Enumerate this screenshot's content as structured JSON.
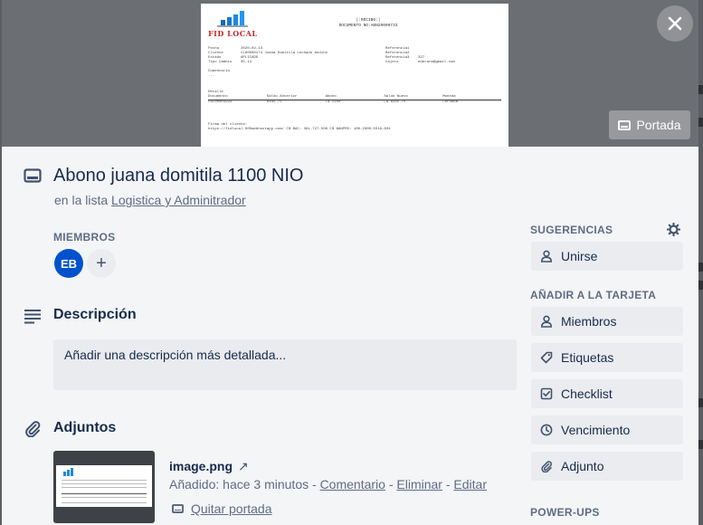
{
  "cover": {
    "portada_label": "Portada",
    "receipt": {
      "logo_text": "FID LOCAL",
      "title_line1": "|:RECIBO:|",
      "title_line2": "DOCUMENTO NO:ABN20000733",
      "fields": [
        {
          "k1": "Fecha",
          "v1": "2020-02-13",
          "k2": "Referencia1",
          "v2": ""
        },
        {
          "k1": "Cliente",
          "v1": "CL00000174 Juana Domitila Lechado Andino",
          "k2": "Referencia2",
          "v2": ""
        },
        {
          "k1": "Estado",
          "v1": "APLICADO",
          "k2": "Referencia3",
          "v2": "327"
        },
        {
          "k1": "Tipo Cambio",
          "v1": "35.14",
          "k2": "Cajero",
          "v2": "ederarm@gmail.com"
        }
      ],
      "comment_label": "Comentario",
      "comment_value": "...",
      "detail_label": "Detalle",
      "table_headers": [
        "Documento",
        "Saldo Anterior",
        "Abono",
        "Saldo Nuevo",
        "Moneda"
      ],
      "table_row": [
        "FAC00003934",
        "8445.75",
        "C$ 1100",
        "C$ 8345.75",
        "Cordoba"
      ],
      "footer_line1": "Firma del cliente:",
      "footer_line2": "https://fidlocal.000webhostapp.com/    C$ BAC: 361-727-506   C$ BANPRO: 100-2000-5518-604"
    }
  },
  "card": {
    "title": "Abono juana domitila 1100 NIO",
    "in_list_prefix": "en la lista",
    "list_name": "Logistica y Adminitrador",
    "members_label": "MIEMBROS",
    "member_initials": "EB",
    "add_member_symbol": "+",
    "description_title": "Descripción",
    "description_placeholder": "Añadir una descripción más detallada...",
    "attachments_title": "Adjuntos",
    "attachment": {
      "name": "image.png",
      "open_symbol": "↗",
      "added_text": "Añadido: hace 3 minutos",
      "sep": " - ",
      "comment_link": "Comentario",
      "delete_link": "Eliminar",
      "edit_link": "Editar",
      "remove_cover_link": "Quitar portada"
    }
  },
  "sidebar": {
    "suggestions_label": "SUGERENCIAS",
    "join_label": "Unirse",
    "add_to_card_label": "AÑADIR A LA TARJETA",
    "buttons": [
      {
        "label": "Miembros",
        "icon": "person-icon"
      },
      {
        "label": "Etiquetas",
        "icon": "tag-icon"
      },
      {
        "label": "Checklist",
        "icon": "checkbox-icon"
      },
      {
        "label": "Vencimiento",
        "icon": "clock-icon"
      },
      {
        "label": "Adjunto",
        "icon": "paperclip-icon"
      }
    ],
    "powerups_label": "POWER-UPS"
  },
  "colors": {
    "panel_bg": "#f4f5f7",
    "button_bg": "#ebecf0",
    "avatar_bg": "#0052cc",
    "text_primary": "#172b4d",
    "text_muted": "#5e6c84",
    "logo_red": "#c62828"
  }
}
